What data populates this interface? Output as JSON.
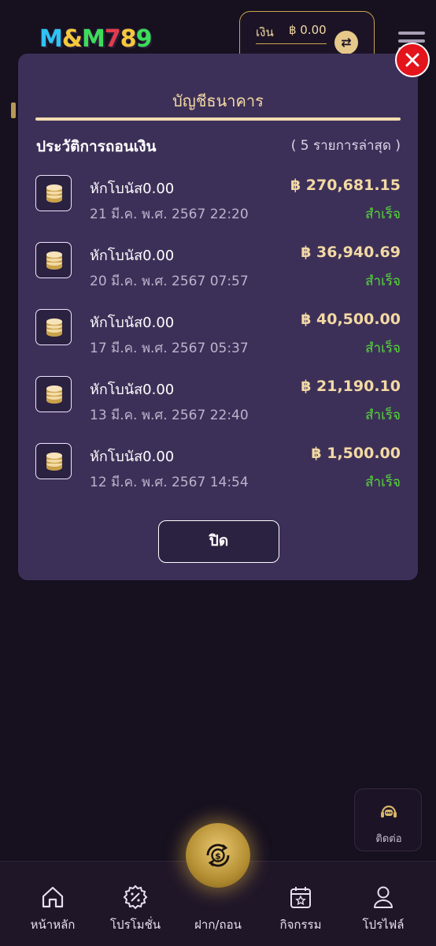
{
  "header": {
    "logo_text": "M&M789",
    "wallet_label": "เงิน",
    "wallet_amount": "฿ 0.00"
  },
  "modal": {
    "title": "บัญชีธนาคาร",
    "history_title": "ประวัติการถอนเงิน",
    "history_count": "( 5 รายการล่าสุด )",
    "close_label": "ปิด",
    "rows": [
      {
        "title": "หักโบนัส0.00",
        "date": "21 มี.ค. พ.ศ. 2567 22:20",
        "amount": "฿ 270,681.15",
        "status": "สำเร็จ"
      },
      {
        "title": "หักโบนัส0.00",
        "date": "20 มี.ค. พ.ศ. 2567 07:57",
        "amount": "฿ 36,940.69",
        "status": "สำเร็จ"
      },
      {
        "title": "หักโบนัส0.00",
        "date": "17 มี.ค. พ.ศ. 2567 05:37",
        "amount": "฿ 40,500.00",
        "status": "สำเร็จ"
      },
      {
        "title": "หักโบนัส0.00",
        "date": "13 มี.ค. พ.ศ. 2567 22:40",
        "amount": "฿ 21,190.10",
        "status": "สำเร็จ"
      },
      {
        "title": "หักโบนัส0.00",
        "date": "12 มี.ค. พ.ศ. 2567 14:54",
        "amount": "฿ 1,500.00",
        "status": "สำเร็จ"
      }
    ]
  },
  "contact": {
    "label": "ติดต่อ"
  },
  "nav": {
    "items": [
      {
        "label": "หน้าหลัก",
        "icon": "home-icon"
      },
      {
        "label": "โปรโมชั่น",
        "icon": "promotion-icon"
      },
      {
        "label": "ฝาก/ถอน",
        "icon": "deposit-withdraw-icon"
      },
      {
        "label": "กิจกรรม",
        "icon": "calendar-star-icon"
      },
      {
        "label": "โปรไฟล์",
        "icon": "user-icon"
      }
    ]
  },
  "colors": {
    "background": "#16101f",
    "modal": "#3d3058",
    "gold": "#f3d9a4",
    "success": "#56d93a",
    "close": "#e3141b"
  }
}
